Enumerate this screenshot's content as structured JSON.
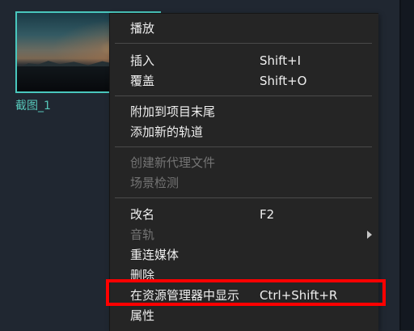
{
  "thumbnail": {
    "label": "截图_1"
  },
  "context_menu": {
    "items": [
      {
        "label": "播放",
        "shortcut": "",
        "disabled": false
      },
      {
        "label": "插入",
        "shortcut": "Shift+I",
        "disabled": false
      },
      {
        "label": "覆盖",
        "shortcut": "Shift+O",
        "disabled": false
      },
      {
        "label": "附加到项目末尾",
        "shortcut": "",
        "disabled": false
      },
      {
        "label": "添加新的轨道",
        "shortcut": "",
        "disabled": false
      },
      {
        "label": "创建新代理文件",
        "shortcut": "",
        "disabled": true
      },
      {
        "label": "场景检测",
        "shortcut": "",
        "disabled": true
      },
      {
        "label": "改名",
        "shortcut": "F2",
        "disabled": false
      },
      {
        "label": "音轨",
        "shortcut": "",
        "disabled": true
      },
      {
        "label": "重连媒体",
        "shortcut": "",
        "disabled": false
      },
      {
        "label": "删除",
        "shortcut": "",
        "disabled": false
      },
      {
        "label": "在资源管理器中显示",
        "shortcut": "Ctrl+Shift+R",
        "disabled": false
      },
      {
        "label": "属性",
        "shortcut": "",
        "disabled": false
      }
    ]
  },
  "icons": {
    "submenu_arrow": "chevron-right-icon"
  },
  "colors": {
    "highlight_border": "#ff0000",
    "selection_accent": "#49c7bd",
    "thumbnail_label": "#57c7ba",
    "menu_background": "#252525"
  }
}
